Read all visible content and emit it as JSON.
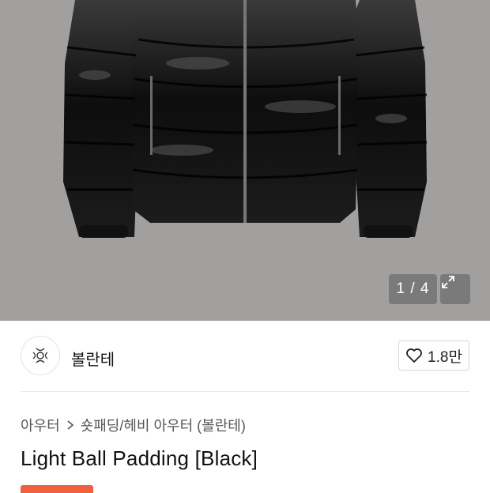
{
  "gallery": {
    "pager_text": "1 / 4",
    "expand_icon": "expand-icon"
  },
  "brand": {
    "name": "볼란테",
    "logo_icon": "brand-logo-icon",
    "like_count": "1.8만",
    "like_icon": "heart-icon"
  },
  "breadcrumb": {
    "items": [
      "아우터",
      "숏패딩/헤비 아우터 (볼란테)"
    ],
    "separator_icon": "chevron-right-icon"
  },
  "product": {
    "title": "Light Ball Padding [Black]"
  },
  "colors": {
    "hero_background": "#a29f9f",
    "accent": "#f05f3e"
  }
}
